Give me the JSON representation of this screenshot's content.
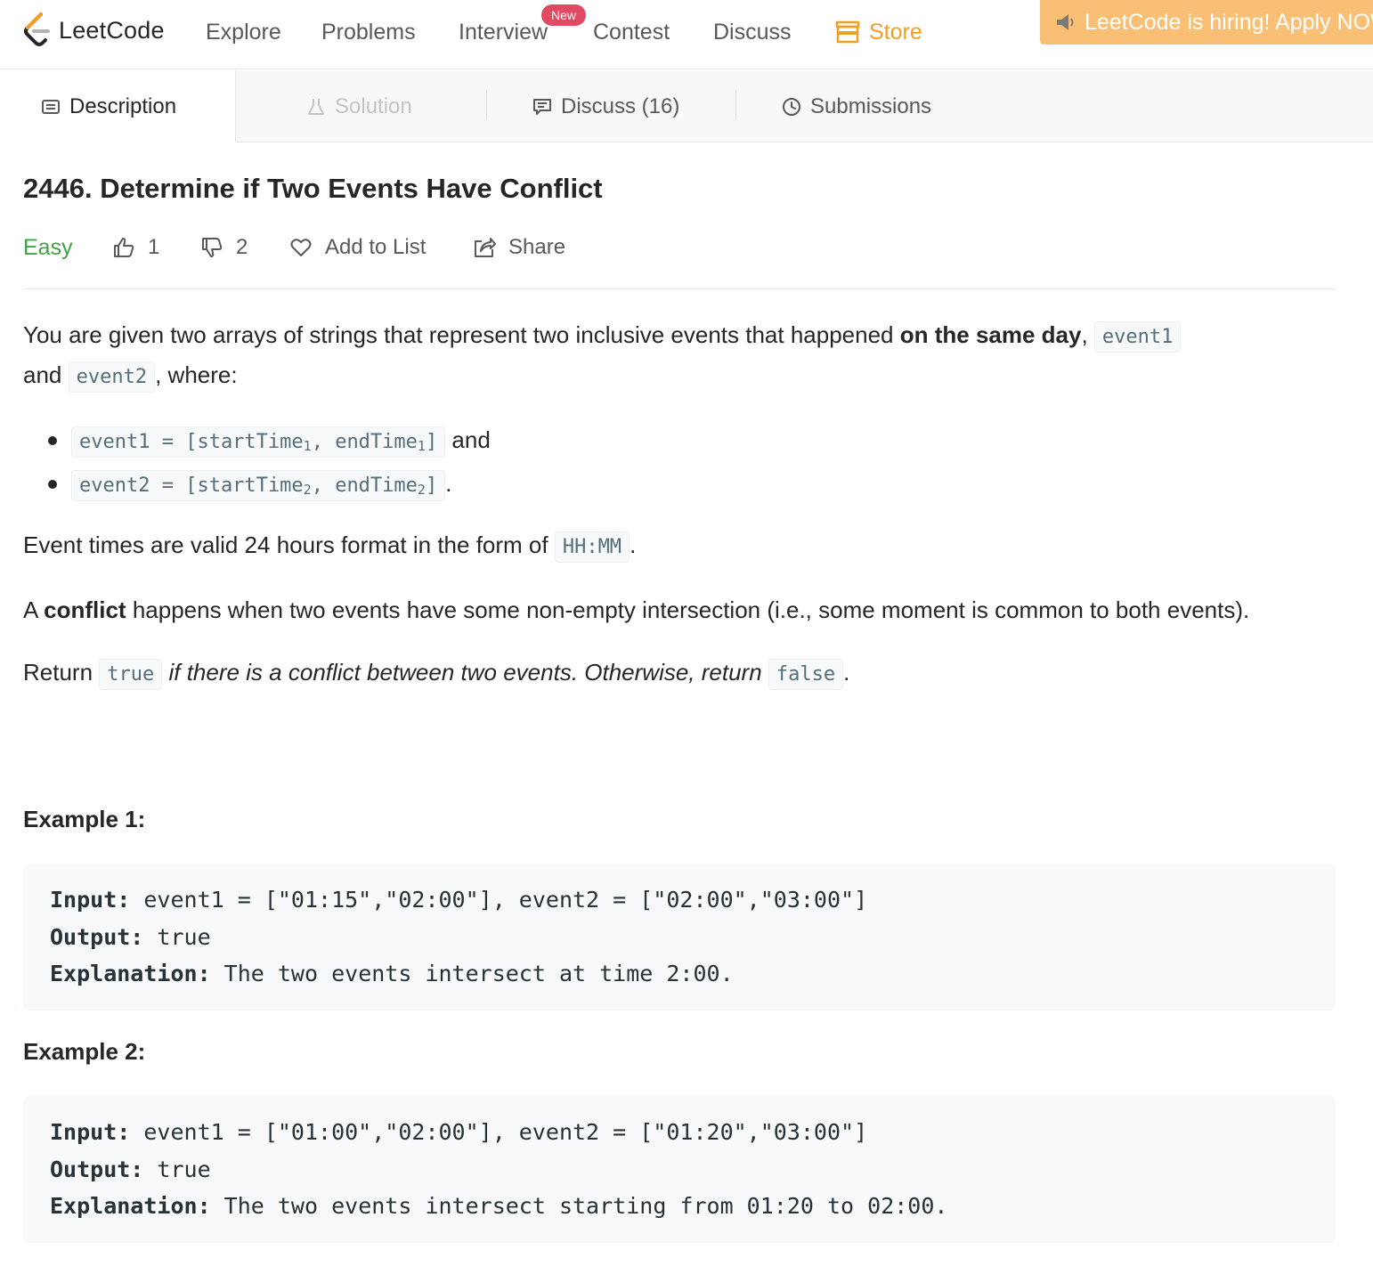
{
  "nav": {
    "logo_text": "LeetCode",
    "items": [
      "Explore",
      "Problems",
      "Interview",
      "Contest",
      "Discuss",
      "Store"
    ],
    "new_badge": "New",
    "hiring_text": "LeetCode is hiring! Apply NOW."
  },
  "tabs": {
    "description": "Description",
    "solution": "Solution",
    "discuss": "Discuss (16)",
    "submissions": "Submissions"
  },
  "problem": {
    "title": "2446. Determine if Two Events Have Conflict",
    "difficulty": "Easy",
    "likes": "1",
    "dislikes": "2",
    "add_to_list": "Add to List",
    "share": "Share"
  },
  "description": {
    "p1_a": "You are given two arrays of strings that represent two inclusive events that happened ",
    "p1_bold": "on the same day",
    "p1_b": ", ",
    "p1_code1": "event1",
    "p1_c": " and ",
    "p1_code2": "event2",
    "p1_d": ", where:",
    "li1_code_a": "event1 = [startTime",
    "li1_sub_a": "1",
    "li1_code_b": ", endTime",
    "li1_sub_b": "1",
    "li1_code_c": "]",
    "li1_tail": " and",
    "li2_code_a": "event2 = [startTime",
    "li2_sub_a": "2",
    "li2_code_b": ", endTime",
    "li2_sub_b": "2",
    "li2_code_c": "]",
    "li2_tail": ".",
    "p2_a": "Event times are valid 24 hours format in the form of ",
    "p2_code": "HH:MM",
    "p2_b": ".",
    "p3_a": "A ",
    "p3_bold": "conflict",
    "p3_b": " happens when two events have some non-empty intersection (i.e., some moment is common to both events).",
    "p4_a": "Return ",
    "p4_code1": "true",
    "p4_italic": " if there is a conflict between two events. Otherwise, return ",
    "p4_code2": "false",
    "p4_b": "."
  },
  "examples": [
    {
      "title": "Example 1:",
      "input_label": "Input:",
      "input": " event1 = [\"01:15\",\"02:00\"], event2 = [\"02:00\",\"03:00\"]",
      "output_label": "Output:",
      "output": " true",
      "explanation_label": "Explanation:",
      "explanation": " The two events intersect at time 2:00."
    },
    {
      "title": "Example 2:",
      "input_label": "Input:",
      "input": " event1 = [\"01:00\",\"02:00\"], event2 = [\"01:20\",\"03:00\"]",
      "output_label": "Output:",
      "output": " true",
      "explanation_label": "Explanation:",
      "explanation": " The two events intersect starting from 01:20 to 02:00."
    }
  ],
  "colors": {
    "easy": "#43a047",
    "store": "#f0a020",
    "hiring_bg": "#f8bf75",
    "new_badge": "#e04a63"
  }
}
